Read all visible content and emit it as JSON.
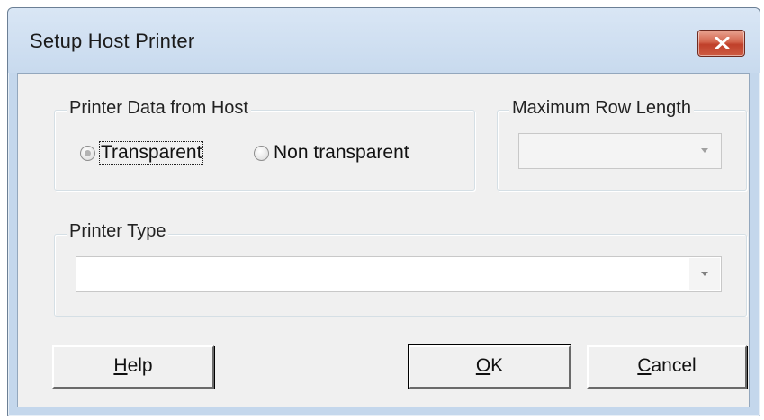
{
  "window": {
    "title": "Setup Host Printer"
  },
  "printer_data_group": {
    "label": "Printer Data from Host",
    "options": [
      {
        "label": "Transparent",
        "selected": true
      },
      {
        "label": "Non transparent",
        "selected": false
      }
    ]
  },
  "max_row_group": {
    "label": "Maximum Row Length",
    "value": ""
  },
  "printer_type_group": {
    "label": "Printer Type",
    "value": ""
  },
  "buttons": {
    "help": {
      "mnemonic": "H",
      "rest": "elp"
    },
    "ok": {
      "mnemonic": "O",
      "rest": "K"
    },
    "cancel": {
      "mnemonic": "C",
      "rest": "ancel"
    }
  },
  "colors": {
    "frame": "#c4d7ec",
    "client": "#f0f0f0",
    "close_button": "#c0402a"
  },
  "icons": [
    "close-icon",
    "chevron-down-icon"
  ]
}
